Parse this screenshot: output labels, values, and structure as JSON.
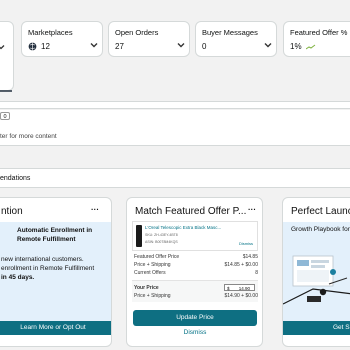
{
  "metrics": [
    {
      "title": "Marketplaces",
      "value": "12",
      "icon": "globe-icon"
    },
    {
      "title": "Open Orders",
      "value": "27"
    },
    {
      "title": "Buyer Messages",
      "value": "0"
    },
    {
      "title": "Featured Offer %",
      "value": "1%"
    }
  ],
  "left_tile": {
    "axis_value": "12"
  },
  "content_strip": {
    "badge_value": "0",
    "text": "ter for more content"
  },
  "section": {
    "title": "endations"
  },
  "cards": {
    "auto": {
      "title": "ntion",
      "menu": "···",
      "headline": "Automatic Enrollment in Remote Fulfillment",
      "body_line1": "new international customers.",
      "body_line2": "enrollment in Remote Fulfillment",
      "body_line3": "in 45 days.",
      "cta": "Learn More or Opt Out"
    },
    "match": {
      "title": "Match Featured Offer P...",
      "menu": "···",
      "product_name": "L'Oreal Telescopic Extra Black Masc...",
      "sku": "SKU: ZH-43EY-4BT8",
      "asin": "ASIN: B00T8M4KQS",
      "dismiss_small": "Dismiss",
      "rows": [
        {
          "label": "Featured Offer Price",
          "value": "$14.85"
        },
        {
          "label": "Price + Shipping",
          "value": "$14.85 + $0.00"
        },
        {
          "label": "Current Offers",
          "value": "8"
        }
      ],
      "your_price_label": "Your Price",
      "currency": "$",
      "your_price_value": "14.90",
      "your_shipping_label": "Price + Shipping",
      "your_shipping_value": "$14.90 + $0.00",
      "update_label": "Update Price",
      "dismiss_label": "Dismiss"
    },
    "launch": {
      "title": "Perfect Launc",
      "subtitle": "Growth Playbook for",
      "cta": "Get S"
    }
  },
  "colors": {
    "teal": "#0e6f82",
    "link": "#007185",
    "blue_panel": "#e3f0fb"
  }
}
